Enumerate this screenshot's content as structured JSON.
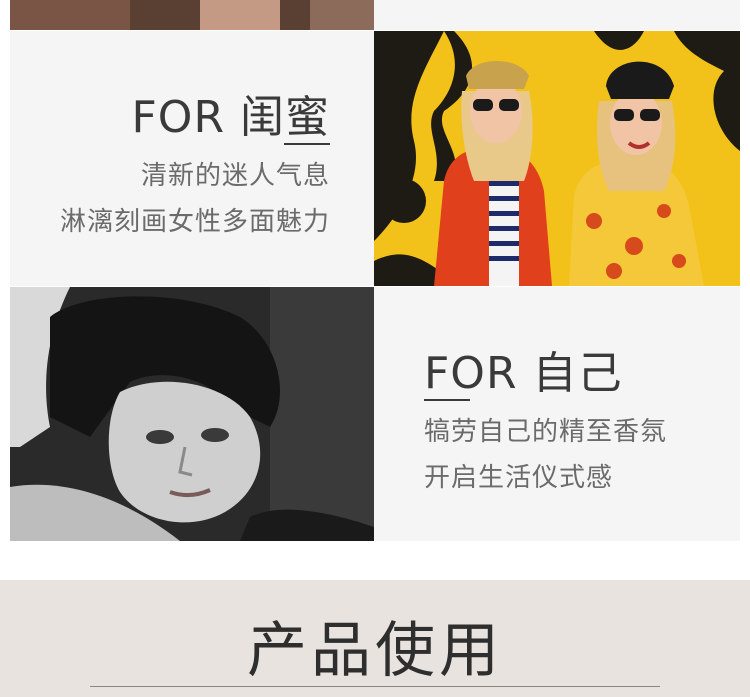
{
  "section_friends": {
    "heading": "FOR 闺蜜",
    "line1": "清新的迷人气息",
    "line2": "淋漓刻画女性多面魅力"
  },
  "section_self": {
    "heading": "FOR 自己",
    "line1": "犒劳自己的精至香氛",
    "line2": "开启生活仪式感"
  },
  "product_usage": {
    "title": "产品使用"
  }
}
